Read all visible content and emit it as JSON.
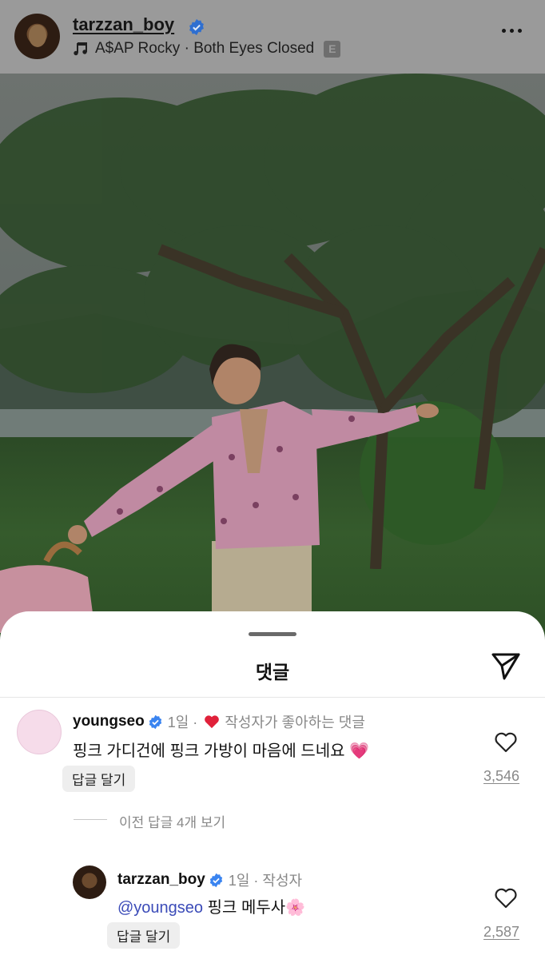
{
  "header": {
    "username": "tarzzan_boy",
    "music": "A$AP Rocky · Both Eyes Closed",
    "explicit_badge": "E",
    "verified_color": "#3a84f0"
  },
  "sheet": {
    "title": "댓글"
  },
  "comments": [
    {
      "username": "youngseo",
      "time": "1일 ·",
      "liked_by_author": "작성자가 좋아하는 댓글",
      "text": "핑크 가디건에 핑크 가방이 마음에 드네요",
      "emoji": "💗",
      "reply_label": "답글 달기",
      "likes": "3,546"
    }
  ],
  "view_previous": "이전 답글 4개 보기",
  "reply": {
    "username": "tarzzan_boy",
    "time": "1일 · 작성자",
    "mention": "@youngseo",
    "text": " 핑크 메두사",
    "emoji": "🌸",
    "reply_label": "답글 달기",
    "likes": "2,587"
  },
  "colors": {
    "accent_verified": "#3a84f0",
    "heart_red": "#e0213a",
    "mention": "#3b4bb8"
  }
}
